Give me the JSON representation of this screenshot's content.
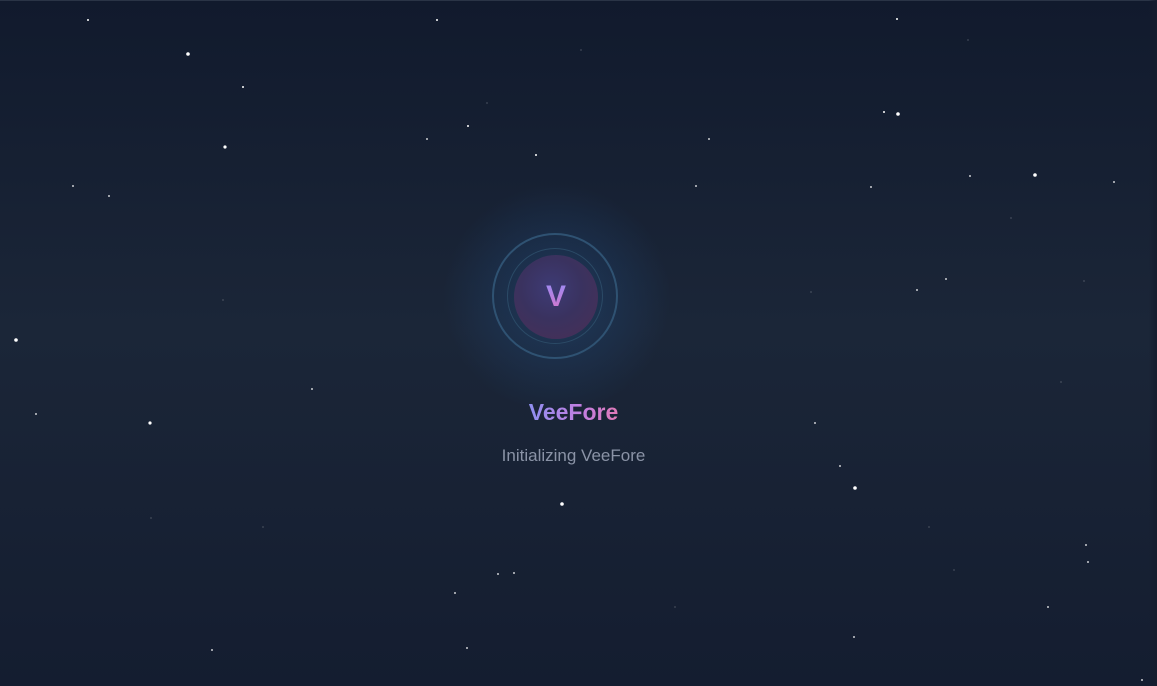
{
  "app": {
    "name": "VeeFore",
    "logo_letter": "V",
    "status_text": "Initializing VeeFore"
  },
  "colors": {
    "background_top": "#111a2d",
    "background_mid": "#1b2638",
    "brand_gradient_start": "#8f8ff0",
    "brand_gradient_end": "#e07ab8",
    "status_text": "#8a93a6",
    "star": "#ffffff"
  },
  "decorations": {
    "background": "starfield",
    "logo_rings": 2
  }
}
